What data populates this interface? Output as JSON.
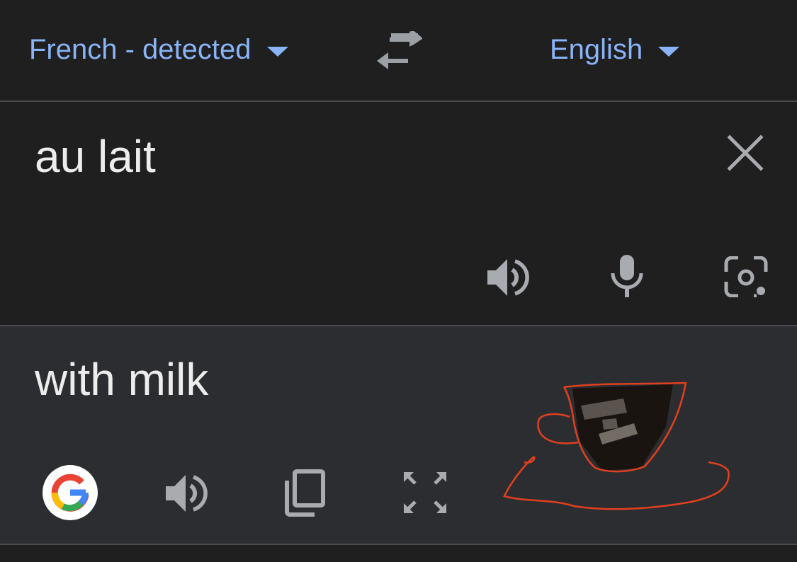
{
  "language_bar": {
    "source_language": "French - detected",
    "target_language": "English"
  },
  "input": {
    "text": "au lait"
  },
  "output": {
    "text": "with milk"
  },
  "icons": {
    "swap": "swap-languages-icon",
    "clear": "close-icon",
    "listen_source": "speaker-icon",
    "voice": "microphone-icon",
    "camera": "camera-icon",
    "google": "google-logo-icon",
    "listen_target": "speaker-icon",
    "copy": "copy-icon",
    "fullscreen": "fullscreen-icon"
  },
  "colors": {
    "accent": "#8ab4f8",
    "background": "#1f1f1f",
    "output_background": "#2c2d31",
    "text": "#ededed",
    "icon": "#a8abb0",
    "annotation": "#e0401f"
  }
}
